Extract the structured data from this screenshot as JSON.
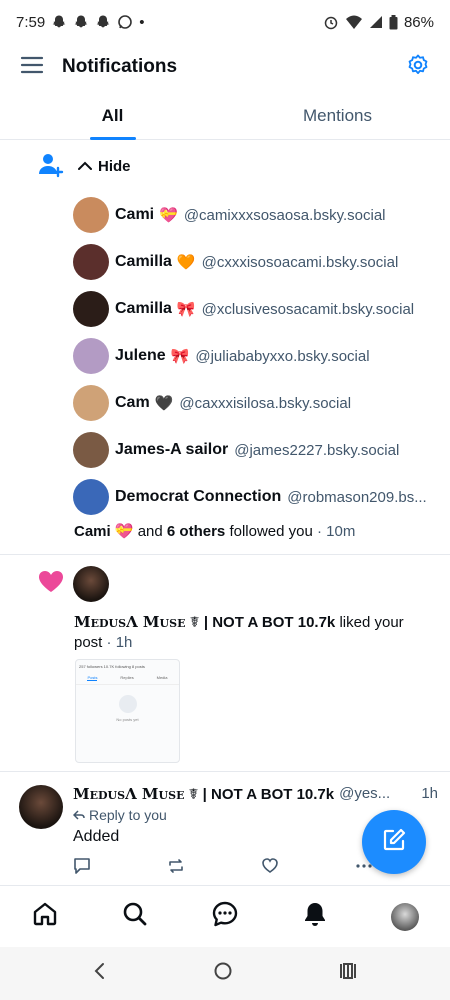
{
  "status_bar": {
    "time": "7:59",
    "dot": "•",
    "battery": "86%"
  },
  "header": {
    "title": "Notifications"
  },
  "tabs": [
    {
      "label": "All",
      "active": true
    },
    {
      "label": "Mentions",
      "active": false
    }
  ],
  "follow_notification": {
    "hide_label": "Hide",
    "followers": [
      {
        "name": "Cami",
        "emoji": "💝",
        "handle": "@camixxxsosaosa.bsky.social",
        "avatar_color": "#c98b5e"
      },
      {
        "name": "Camilla",
        "emoji": "🧡",
        "handle": "@cxxxisosoacami.bsky.social",
        "avatar_color": "#5b2f2c"
      },
      {
        "name": "Camilla",
        "emoji": "🎀",
        "handle": "@xclusivesosacamit.bsky.social",
        "avatar_color": "#2b1d18"
      },
      {
        "name": "Julene",
        "emoji": "🎀",
        "handle": "@juliababyxxo.bsky.social",
        "avatar_color": "#b39bc4"
      },
      {
        "name": "Cam",
        "emoji": "🖤",
        "handle": "@caxxxisilosa.bsky.social",
        "avatar_color": "#cfa277"
      },
      {
        "name": "James-A sailor",
        "emoji": "",
        "handle": "@james2227.bsky.social",
        "avatar_color": "#7a5a44"
      },
      {
        "name": "Democrat Connection",
        "emoji": "",
        "handle": "@robmason209.bs...",
        "avatar_color": "#3a68b8"
      }
    ],
    "summary_name": "Cami",
    "summary_emoji": "💝",
    "summary_and": "and",
    "summary_others": "6 others",
    "summary_action": "followed you",
    "summary_time": "· 10m"
  },
  "like_notification": {
    "name": "MedusΛ Muse",
    "name_suffix": "☤ | NOT A BOT 10.7k",
    "action": "liked your post",
    "time": "· 1h",
    "thumb_stats": "257 followers  10.7K following  8 posts",
    "thumb_tabs": [
      "Posts",
      "Replies",
      "Media"
    ],
    "thumb_empty": "No posts yet"
  },
  "reply_post": {
    "name": "MedusΛ Muse",
    "name_suffix": "☤ | NOT A BOT 10.7k",
    "handle": "@yes...",
    "time": "1h",
    "reply_to": "Reply to you",
    "text": "Added"
  },
  "colors": {
    "accent": "#1083fe",
    "fab": "#1c8cff",
    "heart": "#ec4899",
    "muted": "#42576c"
  }
}
